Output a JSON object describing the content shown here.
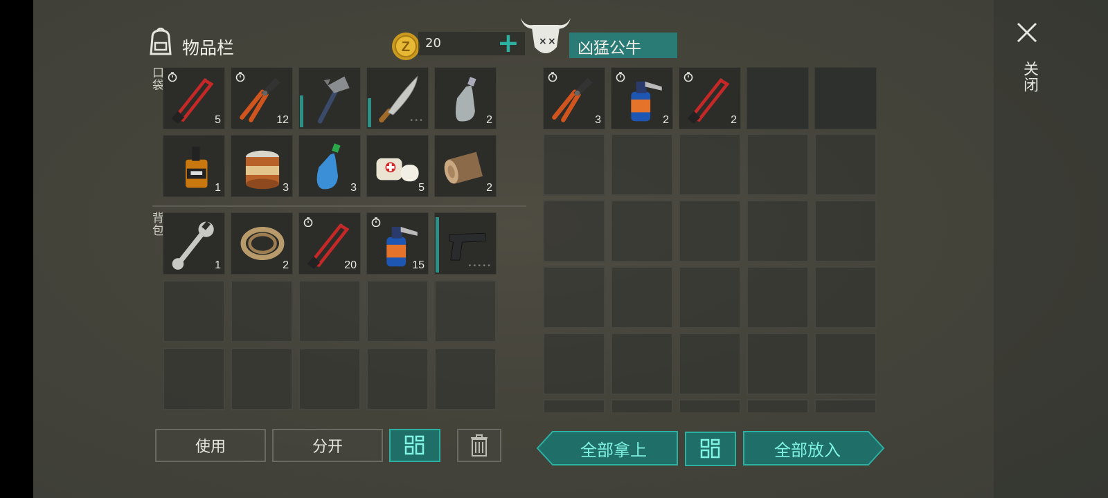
{
  "inventory": {
    "title": "物品栏",
    "currency_amount": "20",
    "currency_symbol": "Z",
    "add_symbol": "+",
    "pocket_label": "口袋",
    "backpack_label": "背包",
    "pocket_items": [
      {
        "icon": "hacksaw-icon",
        "count": "5",
        "timer": true
      },
      {
        "icon": "pliers-icon",
        "count": "12",
        "timer": true
      },
      {
        "icon": "hatchet-icon",
        "count": "",
        "durability": 0.55
      },
      {
        "icon": "machete-icon",
        "count": "",
        "durability": 0.5,
        "dots": "•••"
      },
      {
        "icon": "plastic-bottle-icon",
        "count": "2"
      },
      {
        "icon": "whiskey-bottle-icon",
        "count": "1"
      },
      {
        "icon": "tin-can-icon",
        "count": "3"
      },
      {
        "icon": "water-bottle-icon",
        "count": "3"
      },
      {
        "icon": "bandage-icon",
        "count": "5"
      },
      {
        "icon": "log-icon",
        "count": "2"
      }
    ],
    "backpack_items": [
      {
        "icon": "wrench-icon",
        "count": "1"
      },
      {
        "icon": "rope-icon",
        "count": "2"
      },
      {
        "icon": "hacksaw-icon",
        "count": "20",
        "timer": true
      },
      {
        "icon": "gas-canister-icon",
        "count": "15",
        "timer": true
      },
      {
        "icon": "pistol-icon",
        "count": "",
        "durability": 0.95,
        "dots": "•••••"
      }
    ]
  },
  "container": {
    "title": "凶猛公牛",
    "icon": "bull-skull-icon",
    "items": [
      {
        "icon": "pliers-icon",
        "count": "3",
        "timer": true
      },
      {
        "icon": "gas-canister-icon",
        "count": "2",
        "timer": true
      },
      {
        "icon": "hacksaw-icon",
        "count": "2",
        "timer": true
      }
    ]
  },
  "buttons": {
    "use": "使用",
    "split": "分开",
    "take_all": "全部拿上",
    "put_all": "全部放入"
  },
  "close": {
    "label": "关闭",
    "icon": "close-icon"
  },
  "colors": {
    "accent": "#2bb0a2",
    "accent_dark": "#1f6e67",
    "durability": "#2e8f86"
  }
}
